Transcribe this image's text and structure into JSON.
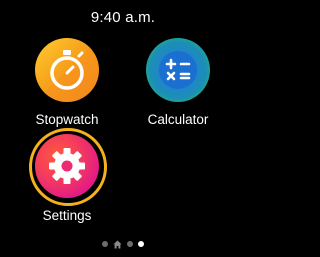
{
  "status": {
    "time": "9:40 a.m."
  },
  "apps": {
    "stopwatch": {
      "label": "Stopwatch",
      "icon": "stopwatch-icon"
    },
    "calculator": {
      "label": "Calculator",
      "icon": "calculator-icon"
    },
    "settings": {
      "label": "Settings",
      "icon": "gear-icon",
      "selected": true
    }
  },
  "pager": {
    "pages": 4,
    "active_index": 3,
    "home_index": 1
  },
  "colors": {
    "background": "#000000",
    "selection_ring": "#f6b21e",
    "dot_inactive": "#6e6e6e",
    "dot_active": "#ffffff"
  }
}
